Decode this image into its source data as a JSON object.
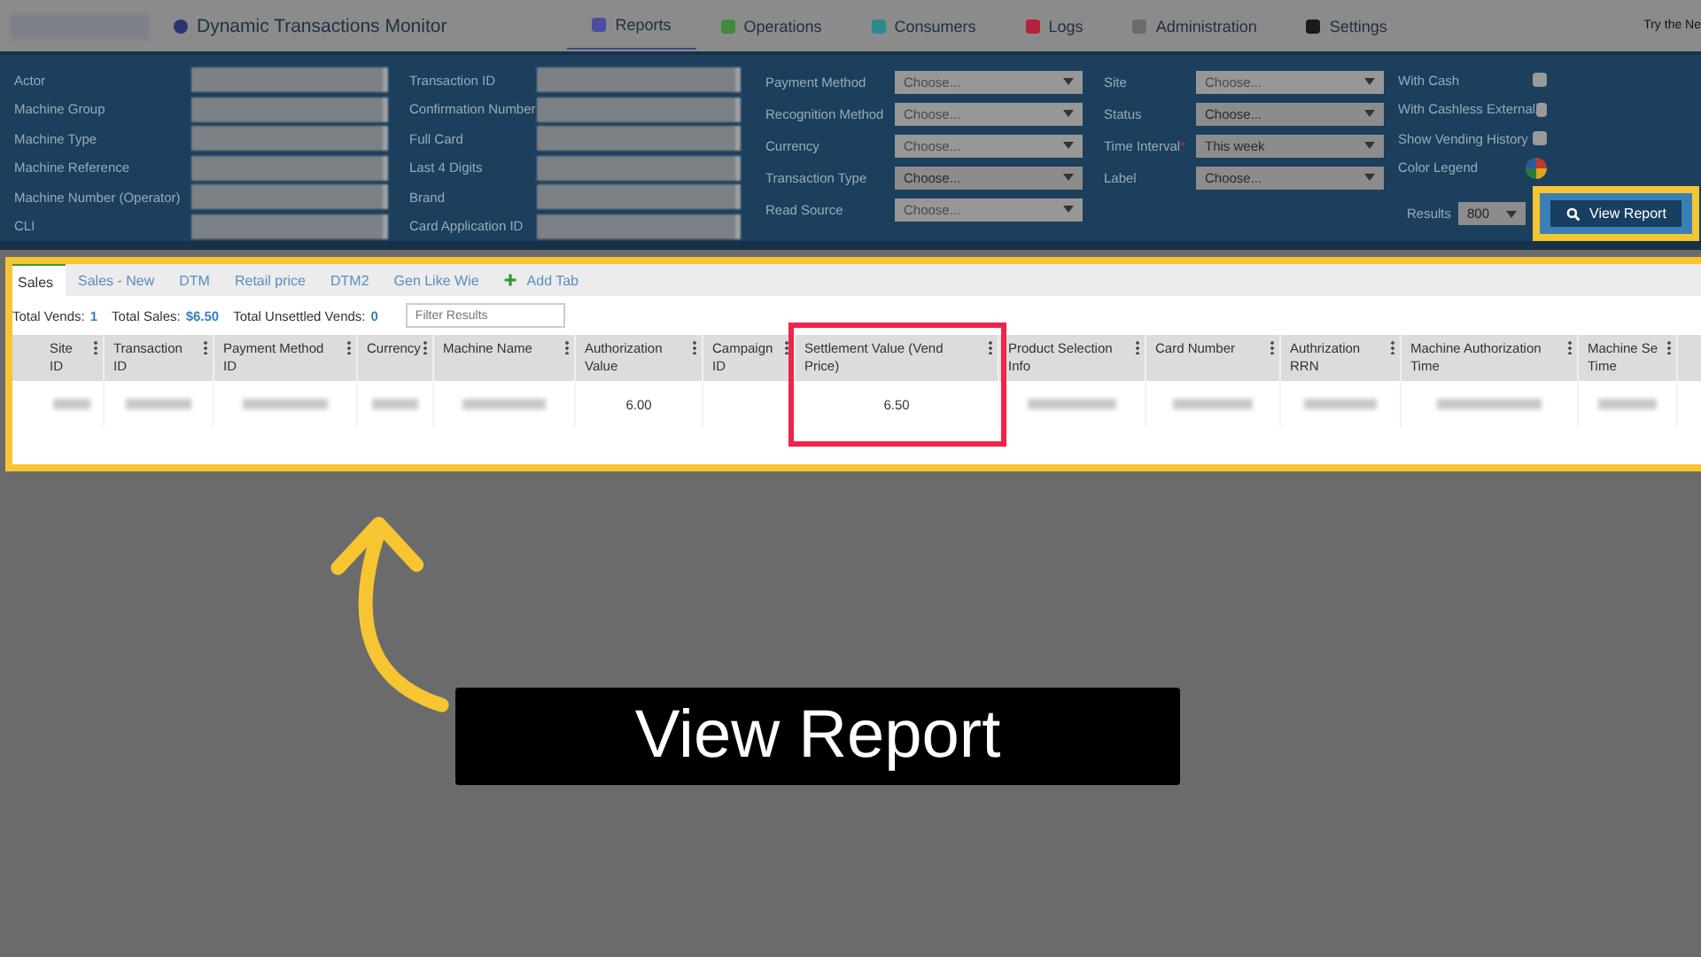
{
  "header": {
    "title": "Dynamic Transactions Monitor",
    "promo": "Try the Ne"
  },
  "nav": [
    {
      "label": "Reports",
      "selected": true,
      "color": "#4b4ea0"
    },
    {
      "label": "Operations",
      "selected": false,
      "color": "#3f8a3c"
    },
    {
      "label": "Consumers",
      "selected": false,
      "color": "#2a8c8c"
    },
    {
      "label": "Logs",
      "selected": false,
      "color": "#b3223f"
    },
    {
      "label": "Administration",
      "selected": false,
      "color": "#6b6b6b"
    },
    {
      "label": "Settings",
      "selected": false,
      "color": "#1a1a1a"
    }
  ],
  "filters": {
    "text_columns": [
      [
        "Actor",
        "Machine Group",
        "Machine Type",
        "Machine Reference",
        "Machine Number (Operator)",
        "CLI"
      ],
      [
        "Transaction ID",
        "Confirmation Number",
        "Full Card",
        "Last 4 Digits",
        "Brand",
        "Card Application ID"
      ]
    ],
    "select_columns": [
      [
        {
          "label": "Payment Method",
          "value": "Choose...",
          "disabled": true
        },
        {
          "label": "Recognition Method",
          "value": "Choose...",
          "disabled": true
        },
        {
          "label": "Currency",
          "value": "Choose...",
          "disabled": true
        },
        {
          "label": "Transaction Type",
          "value": "Choose...",
          "disabled": false
        },
        {
          "label": "Read Source",
          "value": "Choose...",
          "disabled": true
        }
      ],
      [
        {
          "label": "Site",
          "value": "Choose...",
          "disabled": true
        },
        {
          "label": "Status",
          "value": "Choose...",
          "disabled": false
        },
        {
          "label": "Time Interval",
          "marker": "*",
          "value": "This week",
          "disabled": false
        },
        {
          "label": "Label",
          "value": "Choose...",
          "disabled": false
        }
      ]
    ],
    "checkboxes": [
      {
        "label": "With Cash",
        "checked": false
      },
      {
        "label": "With Cashless External",
        "checked": false
      },
      {
        "label": "Show Vending History",
        "checked": false
      }
    ],
    "color_legend": "Color Legend",
    "results": {
      "label": "Results",
      "value": "800"
    },
    "view_report": {
      "label": "View Report",
      "highlighted": true
    }
  },
  "tabs": [
    {
      "label": "Sales",
      "selected": true
    },
    {
      "label": "Sales - New",
      "selected": false
    },
    {
      "label": "DTM",
      "selected": false
    },
    {
      "label": "Retail price",
      "selected": false
    },
    {
      "label": "DTM2",
      "selected": false
    },
    {
      "label": "Gen Like Wie",
      "selected": false
    }
  ],
  "add_tab": "Add Tab",
  "summary": [
    {
      "label": "Total Vends:",
      "value": "1"
    },
    {
      "label": "Total Sales:",
      "value": "$6.50"
    },
    {
      "label": "Total Unsettled Vends:",
      "value": "0"
    }
  ],
  "filter_results": {
    "placeholder": "Filter Results"
  },
  "table": {
    "columns": [
      {
        "label": "Site ID",
        "highlighted": false
      },
      {
        "label": "Transaction ID",
        "highlighted": false
      },
      {
        "label": "Payment Method ID",
        "highlighted": false
      },
      {
        "label": "Currency",
        "highlighted": false
      },
      {
        "label": "Machine Name",
        "highlighted": false
      },
      {
        "label": "Authorization Value",
        "highlighted": false
      },
      {
        "label": "Campaign ID",
        "highlighted": false
      },
      {
        "label": "Settlement Value (Vend Price)",
        "highlighted": true
      },
      {
        "label": "Product Selection Info",
        "highlighted": false
      },
      {
        "label": "Card Number",
        "highlighted": false
      },
      {
        "label": "Authrization RRN",
        "highlighted": false
      },
      {
        "label": "Machine Authorization Time",
        "highlighted": false
      },
      {
        "label": "Machine Se Time",
        "highlighted": false
      }
    ],
    "rows": [
      {
        "cells": [
          {
            "kind": "blurred"
          },
          {
            "kind": "blurred"
          },
          {
            "kind": "blurred"
          },
          {
            "kind": "blurred"
          },
          {
            "kind": "blurred"
          },
          {
            "kind": "text",
            "text": "6.00"
          },
          {
            "kind": "empty"
          },
          {
            "kind": "text",
            "text": "6.50"
          },
          {
            "kind": "blurred"
          },
          {
            "kind": "blurred"
          },
          {
            "kind": "blurred"
          },
          {
            "kind": "blurred"
          },
          {
            "kind": "blurred"
          }
        ]
      }
    ]
  },
  "caption": "View Report"
}
